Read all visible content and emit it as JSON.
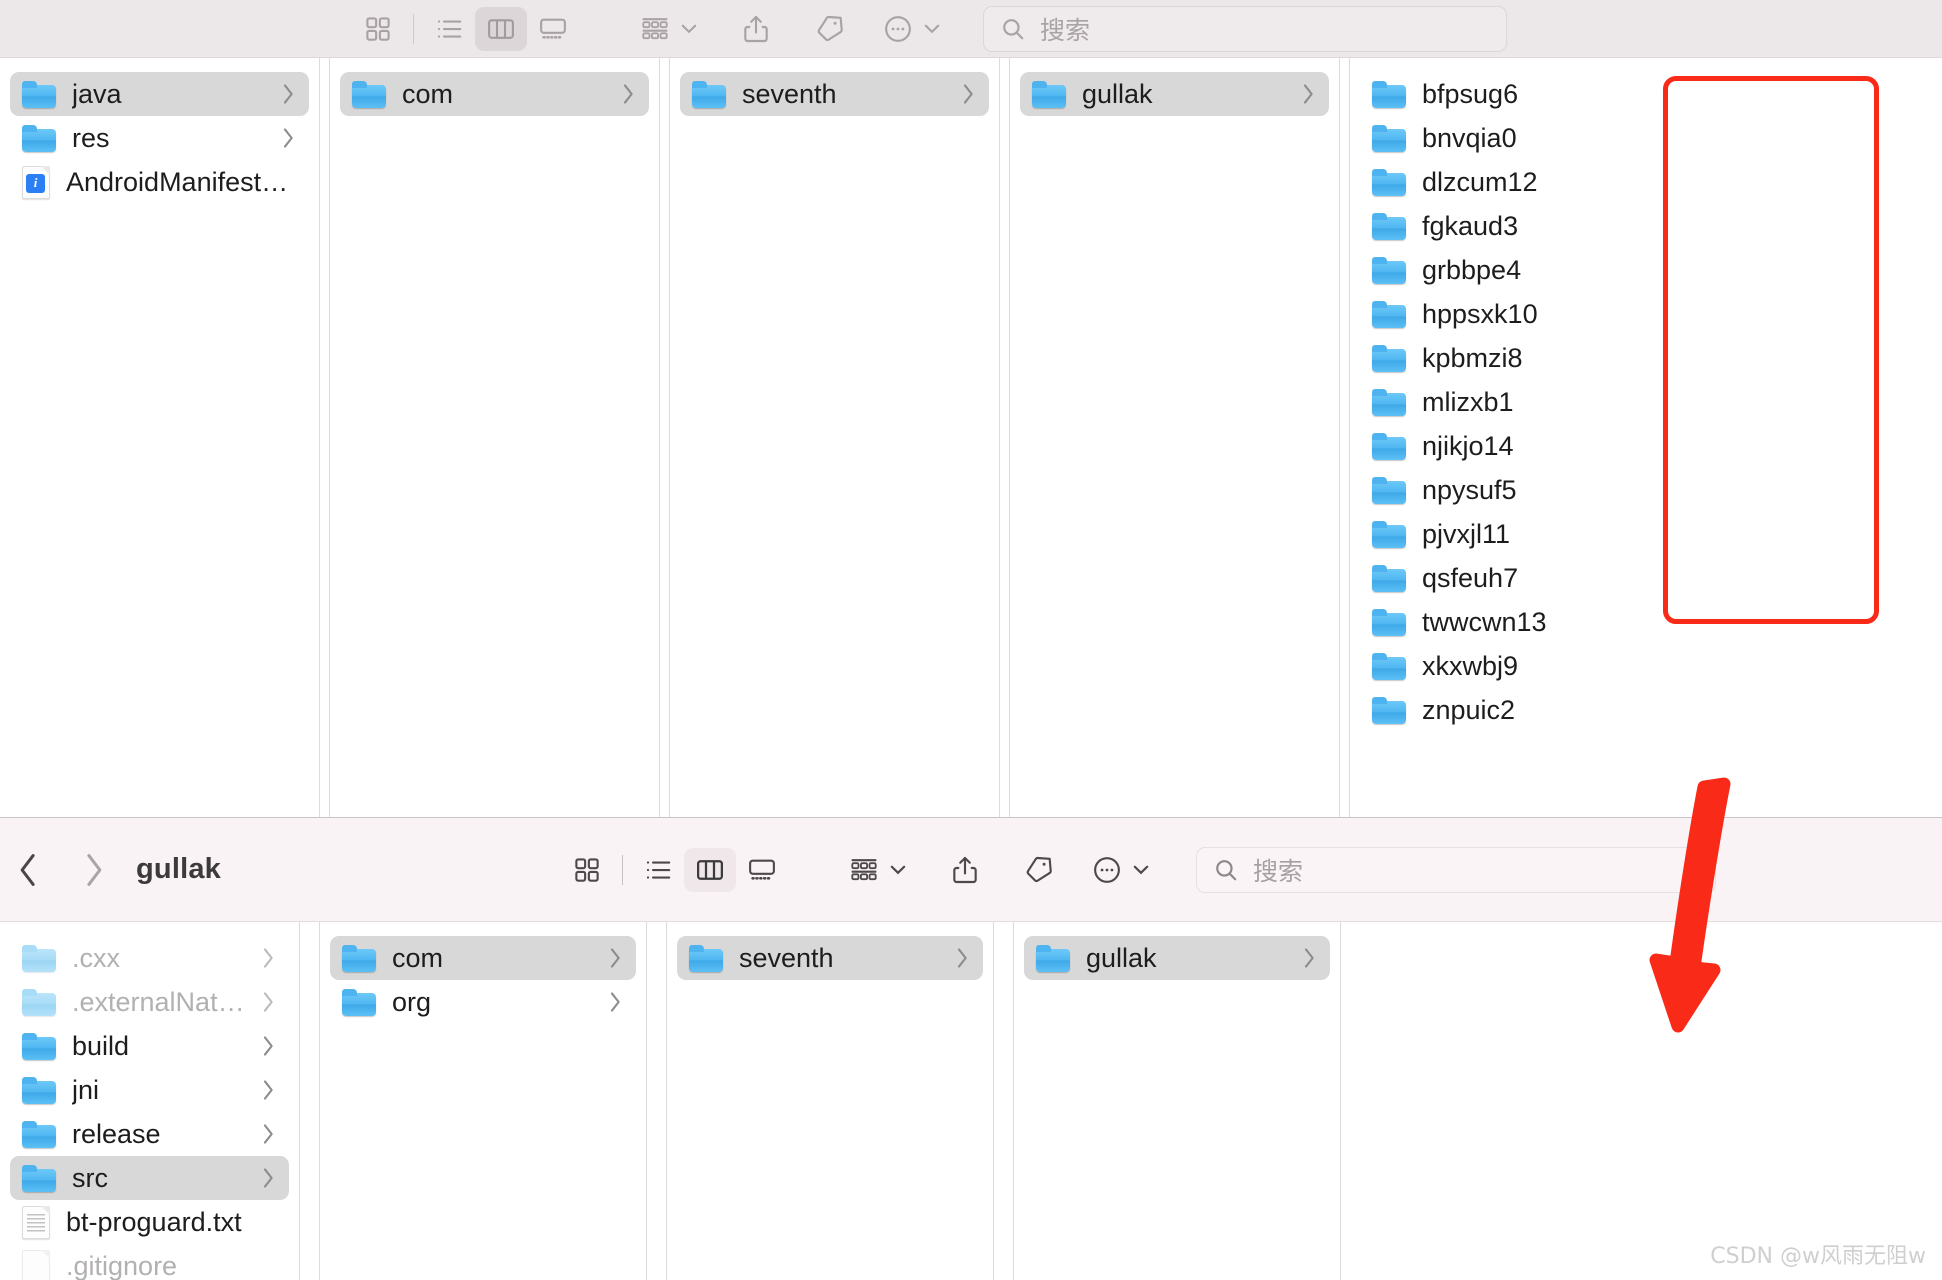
{
  "window_back": {
    "toolbar": {
      "view_buttons": [
        {
          "name": "icon-view",
          "label": "图标显示方式",
          "active": false
        },
        {
          "name": "list-view",
          "label": "列表显示方式",
          "active": false
        },
        {
          "name": "column-view",
          "label": "分栏显示方式",
          "active": true
        },
        {
          "name": "gallery-view",
          "label": "画廊显示方式",
          "active": false
        }
      ],
      "group_label": "分组方式",
      "share_label": "共享",
      "tag_label": "标签",
      "more_label": "更多",
      "search": {
        "placeholder": "搜索",
        "value": ""
      }
    },
    "columns": [
      {
        "name": "column-src",
        "items": [
          {
            "label": "java",
            "type": "folder",
            "selected": true,
            "chevron": true,
            "dimmed": false
          },
          {
            "label": "res",
            "type": "folder",
            "selected": false,
            "chevron": true,
            "dimmed": false
          },
          {
            "label": "AndroidManifest.xml",
            "type": "xml",
            "selected": false,
            "chevron": false,
            "dimmed": false
          }
        ]
      },
      {
        "name": "column-java",
        "items": [
          {
            "label": "com",
            "type": "folder",
            "selected": true,
            "chevron": true,
            "dimmed": false
          }
        ]
      },
      {
        "name": "column-com",
        "items": [
          {
            "label": "seventh",
            "type": "folder",
            "selected": true,
            "chevron": true,
            "dimmed": false
          }
        ]
      },
      {
        "name": "column-seventh",
        "items": [
          {
            "label": "gullak",
            "type": "folder",
            "selected": true,
            "chevron": true,
            "dimmed": false
          }
        ]
      },
      {
        "name": "column-gullak",
        "items": [
          {
            "label": "bfpsug6",
            "type": "folder",
            "selected": false,
            "chevron": false,
            "dimmed": false
          },
          {
            "label": "bnvqia0",
            "type": "folder",
            "selected": false,
            "chevron": false,
            "dimmed": false
          },
          {
            "label": "dlzcum12",
            "type": "folder",
            "selected": false,
            "chevron": false,
            "dimmed": false
          },
          {
            "label": "fgkaud3",
            "type": "folder",
            "selected": false,
            "chevron": false,
            "dimmed": false
          },
          {
            "label": "grbbpe4",
            "type": "folder",
            "selected": false,
            "chevron": false,
            "dimmed": false
          },
          {
            "label": "hppsxk10",
            "type": "folder",
            "selected": false,
            "chevron": false,
            "dimmed": false
          },
          {
            "label": "kpbmzi8",
            "type": "folder",
            "selected": false,
            "chevron": false,
            "dimmed": false
          },
          {
            "label": "mlizxb1",
            "type": "folder",
            "selected": false,
            "chevron": false,
            "dimmed": false
          },
          {
            "label": "njikjo14",
            "type": "folder",
            "selected": false,
            "chevron": false,
            "dimmed": false
          },
          {
            "label": "npysuf5",
            "type": "folder",
            "selected": false,
            "chevron": false,
            "dimmed": false
          },
          {
            "label": "pjvxjl11",
            "type": "folder",
            "selected": false,
            "chevron": false,
            "dimmed": false
          },
          {
            "label": "qsfeuh7",
            "type": "folder",
            "selected": false,
            "chevron": false,
            "dimmed": false
          },
          {
            "label": "twwcwn13",
            "type": "folder",
            "selected": false,
            "chevron": false,
            "dimmed": false
          },
          {
            "label": "xkxwbj9",
            "type": "folder",
            "selected": false,
            "chevron": false,
            "dimmed": false
          },
          {
            "label": "znpuic2",
            "type": "folder",
            "selected": false,
            "chevron": false,
            "dimmed": false
          }
        ]
      }
    ]
  },
  "window_front": {
    "toolbar": {
      "back_label": "后退",
      "forward_label": "前进",
      "title": "gullak",
      "view_buttons": [
        {
          "name": "icon-view",
          "label": "图标显示方式",
          "active": false
        },
        {
          "name": "list-view",
          "label": "列表显示方式",
          "active": false
        },
        {
          "name": "column-view",
          "label": "分栏显示方式",
          "active": true
        },
        {
          "name": "gallery-view",
          "label": "画廊显示方式",
          "active": false
        }
      ],
      "group_label": "分组方式",
      "share_label": "共享",
      "tag_label": "标签",
      "more_label": "更多",
      "search": {
        "placeholder": "搜索",
        "value": ""
      }
    },
    "columns": [
      {
        "name": "column-app",
        "items": [
          {
            "label": ".cxx",
            "type": "folder",
            "selected": false,
            "chevron": true,
            "dimmed": true
          },
          {
            "label": ".externalNativeBuild",
            "type": "folder",
            "selected": false,
            "chevron": true,
            "dimmed": true
          },
          {
            "label": "build",
            "type": "folder",
            "selected": false,
            "chevron": true,
            "dimmed": false
          },
          {
            "label": "jni",
            "type": "folder",
            "selected": false,
            "chevron": true,
            "dimmed": false
          },
          {
            "label": "release",
            "type": "folder",
            "selected": false,
            "chevron": true,
            "dimmed": false
          },
          {
            "label": "src",
            "type": "folder",
            "selected": true,
            "chevron": true,
            "dimmed": false
          },
          {
            "label": "bt-proguard.txt",
            "type": "text",
            "selected": false,
            "chevron": false,
            "dimmed": false
          },
          {
            "label": ".gitignore",
            "type": "file",
            "selected": false,
            "chevron": false,
            "dimmed": true
          }
        ]
      },
      {
        "name": "column-java",
        "items": [
          {
            "label": "com",
            "type": "folder",
            "selected": true,
            "chevron": true,
            "dimmed": false
          },
          {
            "label": "org",
            "type": "folder",
            "selected": false,
            "chevron": true,
            "dimmed": false
          }
        ]
      },
      {
        "name": "column-com",
        "items": [
          {
            "label": "seventh",
            "type": "folder",
            "selected": true,
            "chevron": true,
            "dimmed": false
          }
        ]
      },
      {
        "name": "column-seventh",
        "items": [
          {
            "label": "gullak",
            "type": "folder",
            "selected": true,
            "chevron": true,
            "dimmed": false
          }
        ]
      },
      {
        "name": "column-gullak-empty",
        "items": []
      }
    ]
  },
  "annotations": {
    "highlight_box": {
      "name": "folder-list-highlight",
      "color": "#fa2a18"
    },
    "arrow": {
      "name": "pointer-arrow",
      "color": "#fa2a18",
      "direction": "down-left"
    }
  },
  "watermark": {
    "text": "CSDN @w风雨无阻w"
  }
}
